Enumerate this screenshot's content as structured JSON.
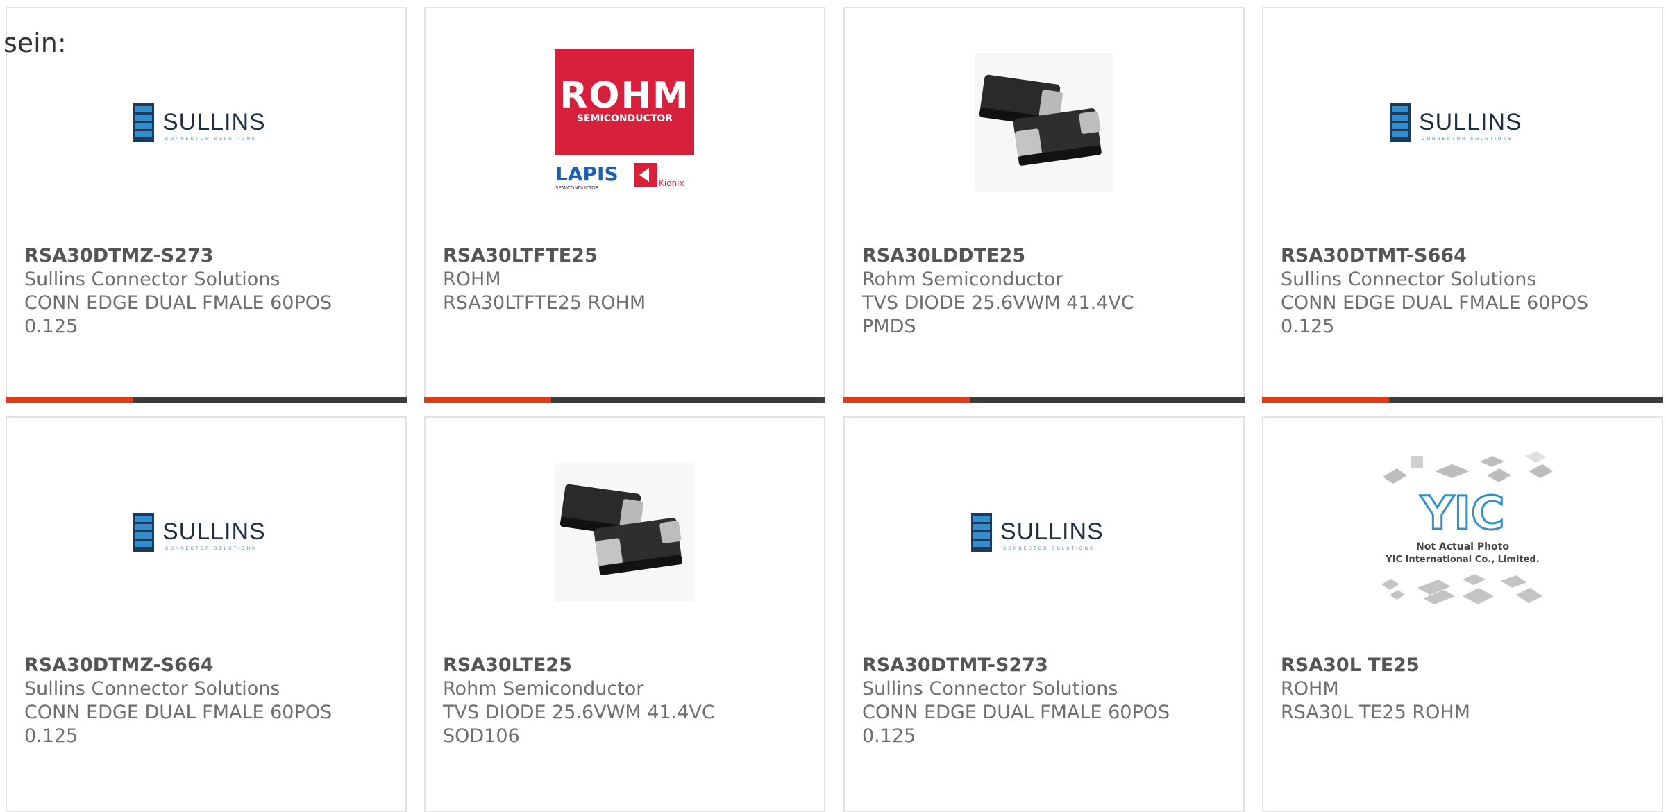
{
  "page": {
    "lead_text": "sein:"
  },
  "brand_colors": {
    "accent": "#e23a15",
    "bar": "#3c3c3c",
    "border": "#e3e3e3",
    "sullins_blue": "#1a6fb5",
    "rohm_red": "#d7203b"
  },
  "products": [
    {
      "part_number": "RSA30DTMZ-S273",
      "manufacturer": "Sullins Connector Solutions",
      "desc1": "CONN EDGE DUAL FMALE 60POS",
      "desc2": "0.125",
      "image": "sullins-logo"
    },
    {
      "part_number": "RSA30LTFTE25",
      "manufacturer": "ROHM",
      "desc1": "RSA30LTFTE25 ROHM",
      "desc2": "",
      "image": "rohm-logo"
    },
    {
      "part_number": "RSA30LDDTE25",
      "manufacturer": "Rohm Semiconductor",
      "desc1": "TVS DIODE 25.6VWM 41.4VC",
      "desc2": "PMDS",
      "image": "diode-photo"
    },
    {
      "part_number": "RSA30DTMT-S664",
      "manufacturer": "Sullins Connector Solutions",
      "desc1": "CONN EDGE DUAL FMALE 60POS",
      "desc2": "0.125",
      "image": "sullins-logo"
    },
    {
      "part_number": "RSA30DTMZ-S664",
      "manufacturer": "Sullins Connector Solutions",
      "desc1": "CONN EDGE DUAL FMALE 60POS",
      "desc2": "0.125",
      "image": "sullins-logo"
    },
    {
      "part_number": "RSA30LTE25",
      "manufacturer": "Rohm Semiconductor",
      "desc1": "TVS DIODE 25.6VWM 41.4VC",
      "desc2": "SOD106",
      "image": "diode-photo"
    },
    {
      "part_number": "RSA30DTMT-S273",
      "manufacturer": "Sullins Connector Solutions",
      "desc1": "CONN EDGE DUAL FMALE 60POS",
      "desc2": "0.125",
      "image": "sullins-logo"
    },
    {
      "part_number": "RSA30L TE25",
      "manufacturer": "ROHM",
      "desc1": "RSA30L TE25 ROHM",
      "desc2": "",
      "image": "yic-placeholder"
    }
  ],
  "logos": {
    "sullins": {
      "name": "SULLINS",
      "tagline": "CONNECTOR SOLUTIONS"
    },
    "rohm": {
      "name": "ROHM",
      "sub": "SEMICONDUCTOR",
      "lapis": "LAPIS",
      "lapis_sub": "SEMICONDUCTOR",
      "kionix": "Kionix"
    },
    "yic": {
      "mark": "YIC",
      "line1": "Not Actual Photo",
      "line2": "YIC International Co., Limited."
    }
  }
}
